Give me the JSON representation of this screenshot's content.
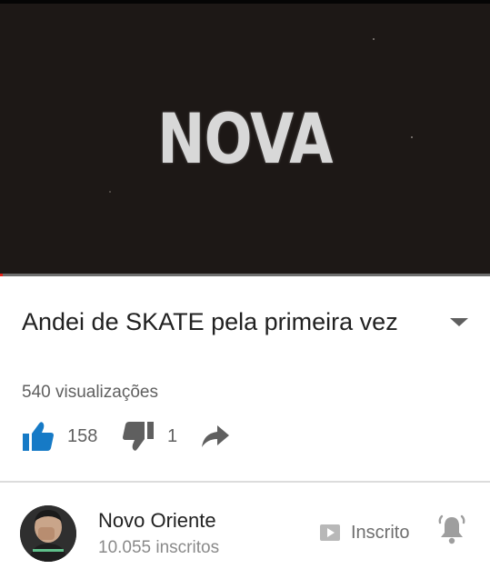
{
  "player": {
    "frame_text": "NOVA",
    "progress_fraction": 0.006,
    "progress_color": "#e62117"
  },
  "video": {
    "title": "Andei de SKATE pela primeira vez",
    "views": "540 visualizações",
    "likes": "158",
    "dislikes": "1"
  },
  "icons": {
    "expand": "chevron-down-icon",
    "like": "thumbs-up-icon",
    "dislike": "thumbs-down-icon",
    "share": "share-icon",
    "subscribed": "subscribed-play-icon",
    "notifications": "bell-icon"
  },
  "colors": {
    "accent_blue": "#167ac6",
    "icon_gray": "#5f5f5f",
    "light_icon_gray": "#9e9e9e"
  },
  "channel": {
    "name": "Novo Oriente",
    "subscribers": "10.055 inscritos",
    "subscribe_label": "Inscrito"
  }
}
